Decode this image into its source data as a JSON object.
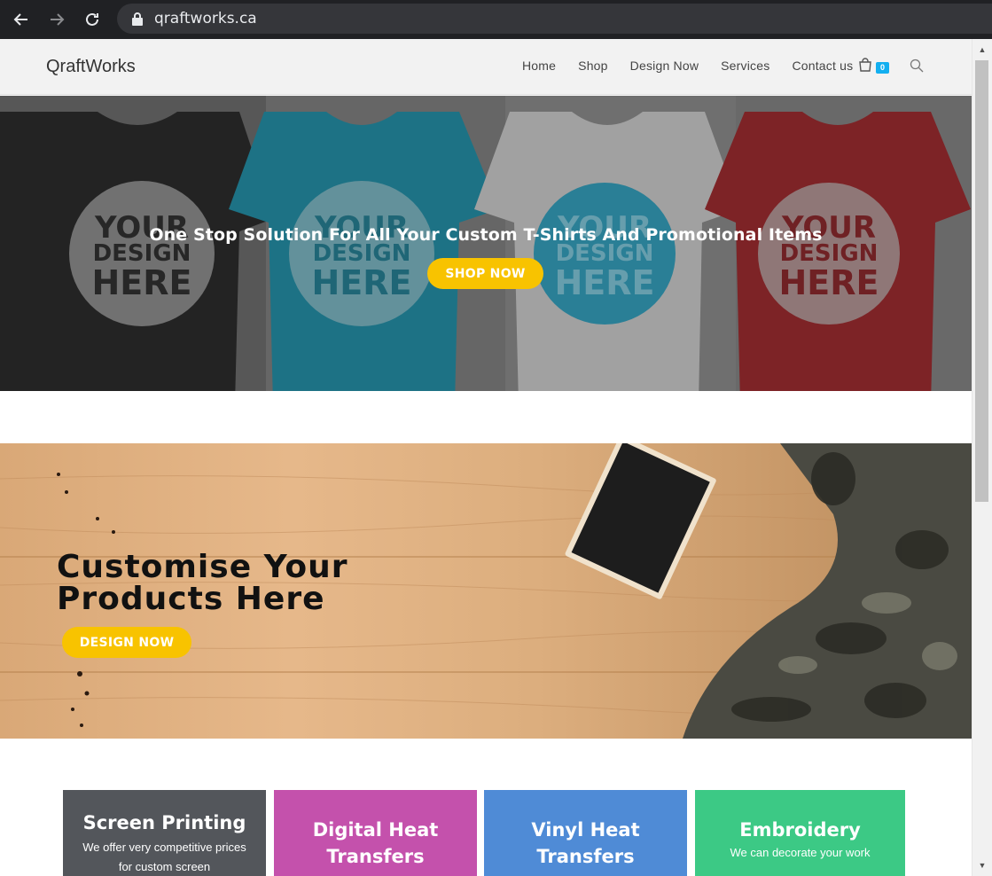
{
  "browser": {
    "url": "qraftworks.ca",
    "icons": [
      "back-arrow-icon",
      "forward-arrow-icon",
      "reload-icon",
      "lock-icon"
    ]
  },
  "header": {
    "logo": "QraftWorks",
    "nav": [
      "Home",
      "Shop",
      "Design Now",
      "Services",
      "Contact us"
    ],
    "cart_count": "0"
  },
  "hero": {
    "shirt_prints": [
      {
        "line1": "YOUR",
        "line2": "DESIGN",
        "line3": "HERE"
      },
      {
        "line1": "YOUR",
        "line2": "DESIGN",
        "line3": "HERE"
      },
      {
        "line1": "YOUR",
        "line2": "DESIGN",
        "line3": "HERE"
      },
      {
        "line1": "YOUR",
        "line2": "DESIGN",
        "line3": "HERE"
      }
    ],
    "headline": "One Stop Solution For All Your Custom T-Shirts And Promotional Items",
    "button": "SHOP NOW",
    "colors": {
      "accent": "#f8c300"
    }
  },
  "customise": {
    "title_line1": "Customise Your",
    "title_line2": "Products Here",
    "button": "DESIGN NOW"
  },
  "services": [
    {
      "title_line1": "Screen Printing",
      "title_line2": "",
      "desc": "We offer very competitive prices for custom screen",
      "color": "#53565b"
    },
    {
      "title_line1": "Digital Heat",
      "title_line2": "Transfers",
      "desc": "",
      "color": "#c451ac"
    },
    {
      "title_line1": "Vinyl Heat",
      "title_line2": "Transfers",
      "desc": "",
      "color": "#4f8bd6"
    },
    {
      "title_line1": "Embroidery",
      "title_line2": "",
      "desc": "We can decorate your work",
      "color": "#3cc985"
    }
  ]
}
